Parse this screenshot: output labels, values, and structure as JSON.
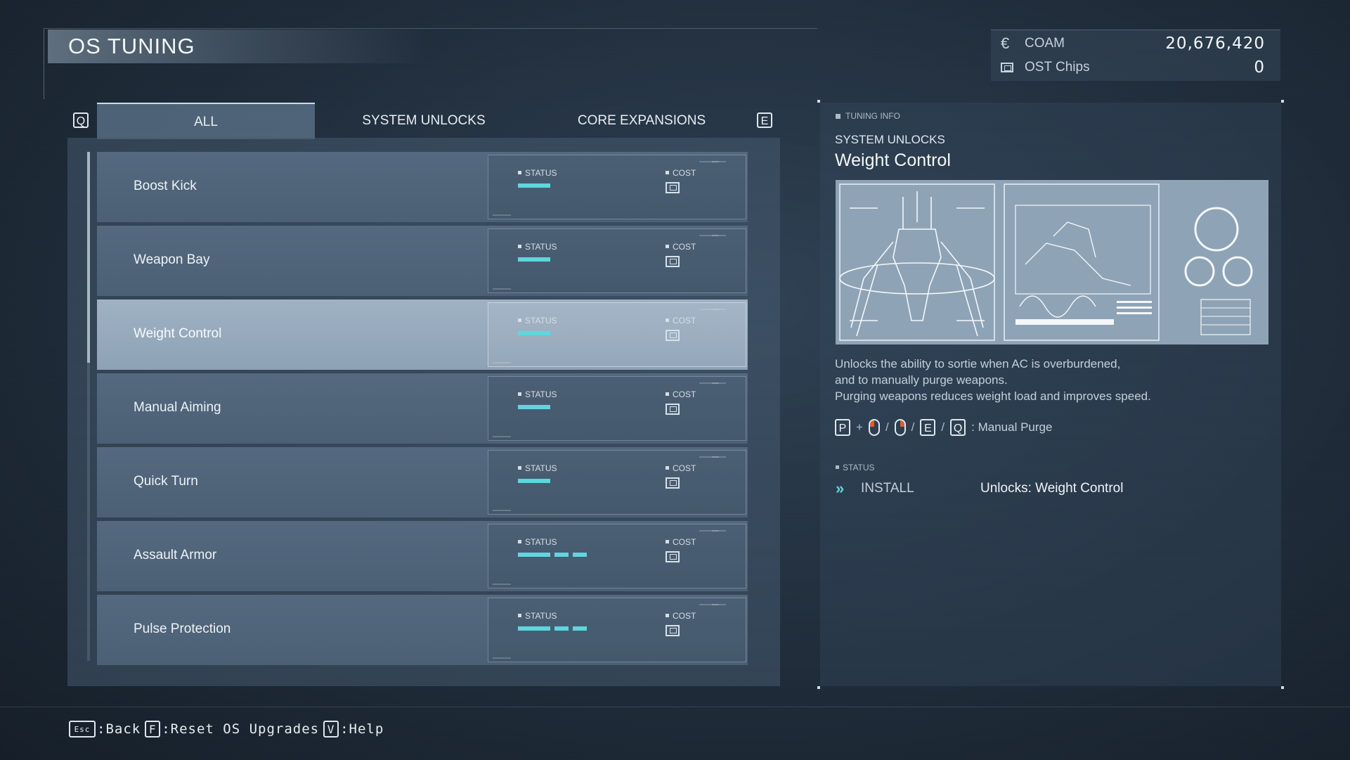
{
  "header": {
    "title": "OS TUNING"
  },
  "currency": {
    "coam": {
      "icon": "coam-icon",
      "label": "COAM",
      "value": "20,676,420"
    },
    "ost": {
      "icon": "ost-chip-icon",
      "label": "OST Chips",
      "value": "0"
    }
  },
  "tabs": {
    "prev_key": "Q",
    "next_key": "E",
    "items": [
      {
        "label": "ALL",
        "active": true
      },
      {
        "label": "SYSTEM UNLOCKS",
        "active": false
      },
      {
        "label": "CORE EXPANSIONS",
        "active": false
      }
    ]
  },
  "list": {
    "status_label": "STATUS",
    "cost_label": "COST",
    "items": [
      {
        "name": "Boost Kick",
        "levels": 1,
        "selected": false
      },
      {
        "name": "Weapon Bay",
        "levels": 1,
        "selected": false
      },
      {
        "name": "Weight Control",
        "levels": 1,
        "selected": true
      },
      {
        "name": "Manual Aiming",
        "levels": 1,
        "selected": false
      },
      {
        "name": "Quick Turn",
        "levels": 1,
        "selected": false
      },
      {
        "name": "Assault Armor",
        "levels": 3,
        "selected": false
      },
      {
        "name": "Pulse Protection",
        "levels": 3,
        "selected": false
      }
    ]
  },
  "info": {
    "tag": "TUNING INFO",
    "category": "SYSTEM UNLOCKS",
    "title": "Weight Control",
    "description": [
      "Unlocks the ability to sortie when AC is overburdened,",
      "and to manually purge weapons.",
      "Purging weapons reduces weight load and improves speed."
    ],
    "controls": {
      "key1": "P",
      "plus": "+",
      "key2": "E",
      "key3": "Q",
      "slash": "/",
      "action": ": Manual Purge"
    },
    "status_tag": "STATUS",
    "install_label": "INSTALL",
    "install_value": "Unlocks: Weight Control"
  },
  "footer": {
    "esc": "Esc",
    "back": ":Back",
    "reset_key": "F",
    "reset": ":Reset OS Upgrades",
    "help_key": "V",
    "help": ":Help"
  },
  "colors": {
    "accent": "#5fd6de",
    "mouse_button": "#e65b2f"
  }
}
